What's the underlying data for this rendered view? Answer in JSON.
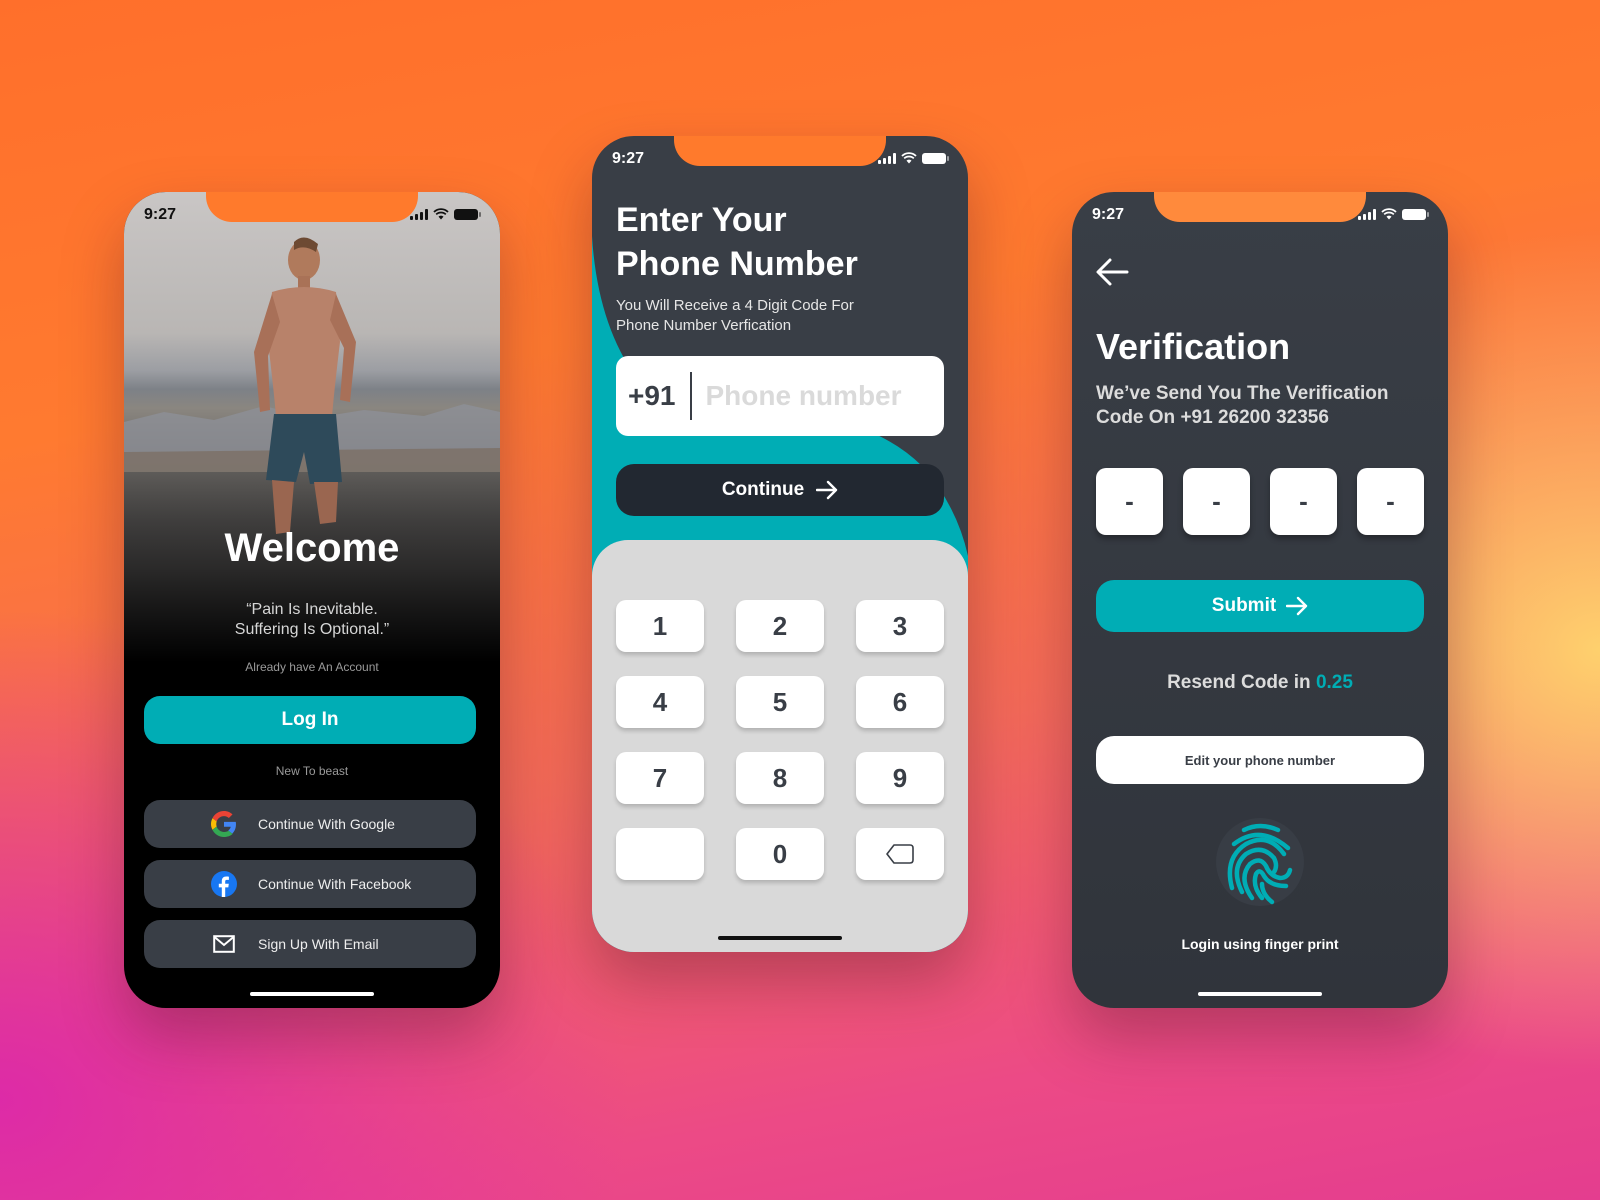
{
  "colors": {
    "accent": "#00adb5",
    "dark": "#393e46",
    "darker": "#222831",
    "keypad_bg": "#d9d9d9"
  },
  "status_bar": {
    "time": "9:27",
    "icons": [
      "signal-icon",
      "wifi-icon",
      "battery-icon"
    ]
  },
  "welcome_screen": {
    "title": "Welcome",
    "quote_line1": "“Pain Is Inevitable.",
    "quote_line2": "Suffering Is Optional.”",
    "already_text": "Already  have An Account",
    "login_label": "Log In",
    "new_to_text": "New To beast",
    "social_buttons": [
      {
        "icon": "google-icon",
        "label": "Continue With Google"
      },
      {
        "icon": "facebook-icon",
        "label": "Continue With Facebook"
      },
      {
        "icon": "email-icon",
        "label": "Sign Up With Email"
      }
    ]
  },
  "phone_screen": {
    "title_line1": "Enter Your",
    "title_line2": "Phone Number",
    "subtitle_line1": "You Will Receive a 4 Digit Code For",
    "subtitle_line2": "Phone Number Verfication",
    "country_code": "+91",
    "phone_value": "",
    "phone_placeholder": "Phone number",
    "continue_label": "Continue",
    "keys": [
      "1",
      "2",
      "3",
      "4",
      "5",
      "6",
      "7",
      "8",
      "9",
      "",
      "0",
      "backspace"
    ]
  },
  "verification_screen": {
    "title": "Verification",
    "subtitle_line1": "We’ve Send You The Verification",
    "subtitle_line2": "Code On +91 26200 32356",
    "otp_digits": [
      "-",
      "-",
      "-",
      "-"
    ],
    "submit_label": "Submit",
    "resend_text": "Resend Code in ",
    "resend_timer": "0.25",
    "edit_label": "Edit your phone number",
    "fingerprint_label": "Login using finger print"
  }
}
